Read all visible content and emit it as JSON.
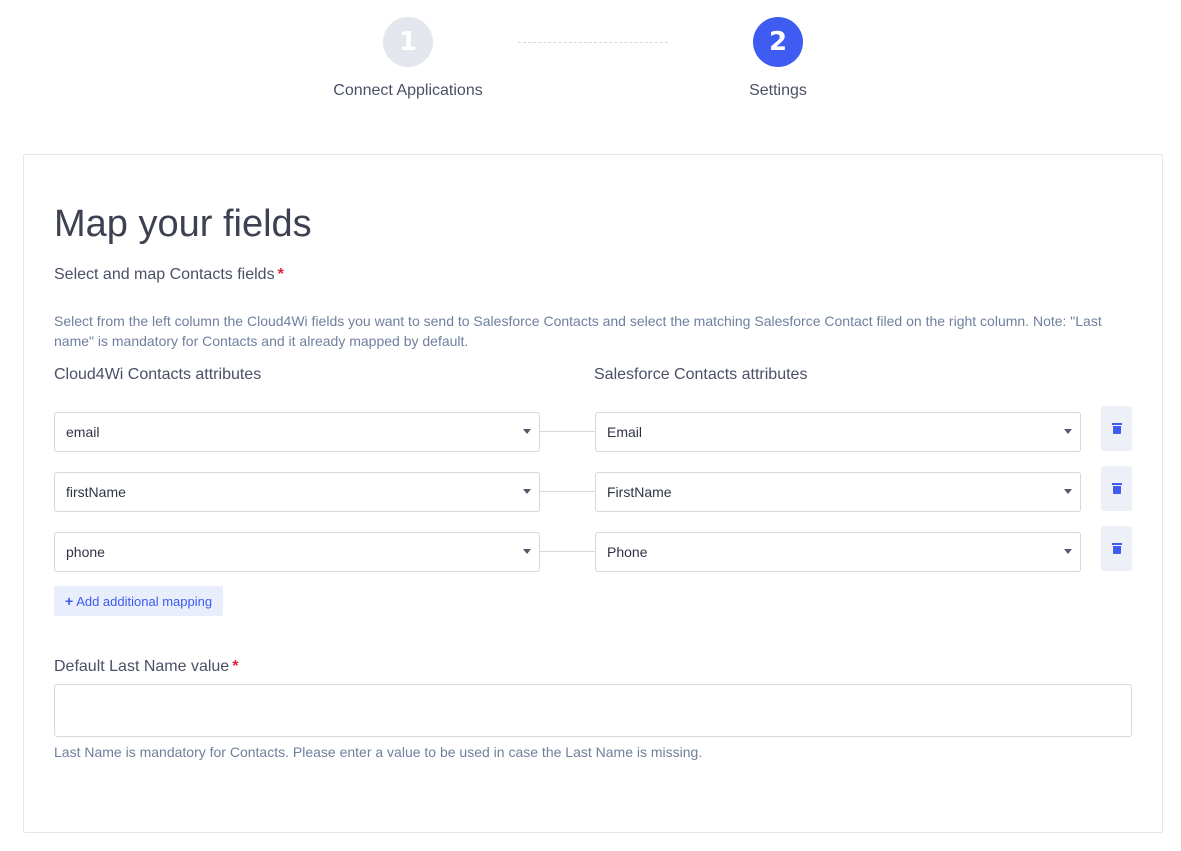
{
  "stepper": {
    "steps": [
      {
        "number": "1",
        "label": "Connect Applications",
        "state": "completed"
      },
      {
        "number": "2",
        "label": "Settings",
        "state": "active"
      }
    ]
  },
  "card": {
    "title": "Map your fields",
    "section_label": "Select and map Contacts fields",
    "required_marker": "*",
    "description": "Select from the left column the Cloud4Wi fields you want to send to Salesforce Contacts and select the matching Salesforce Contact filed on the right column. Note: \"Last name\" is mandatory for Contacts and it already mapped by default.",
    "left_column_header": "Cloud4Wi Contacts attributes",
    "right_column_header": "Salesforce Contacts attributes",
    "mappings": [
      {
        "source": "email",
        "target": "Email"
      },
      {
        "source": "firstName",
        "target": "FirstName"
      },
      {
        "source": "phone",
        "target": "Phone"
      }
    ],
    "add_mapping_label": "Add additional mapping",
    "last_name_label": "Default Last Name value",
    "last_name_value": "",
    "last_name_help": "Last Name is mandatory for Contacts. Please enter a value to be used in case the Last Name is missing."
  },
  "icons": {
    "delete": "trash-icon",
    "add": "plus-icon",
    "dropdown": "caret-down-icon"
  },
  "colors": {
    "accent": "#3e5bf2",
    "required": "#e1253a",
    "inactive_step": "#e3e6ec"
  }
}
